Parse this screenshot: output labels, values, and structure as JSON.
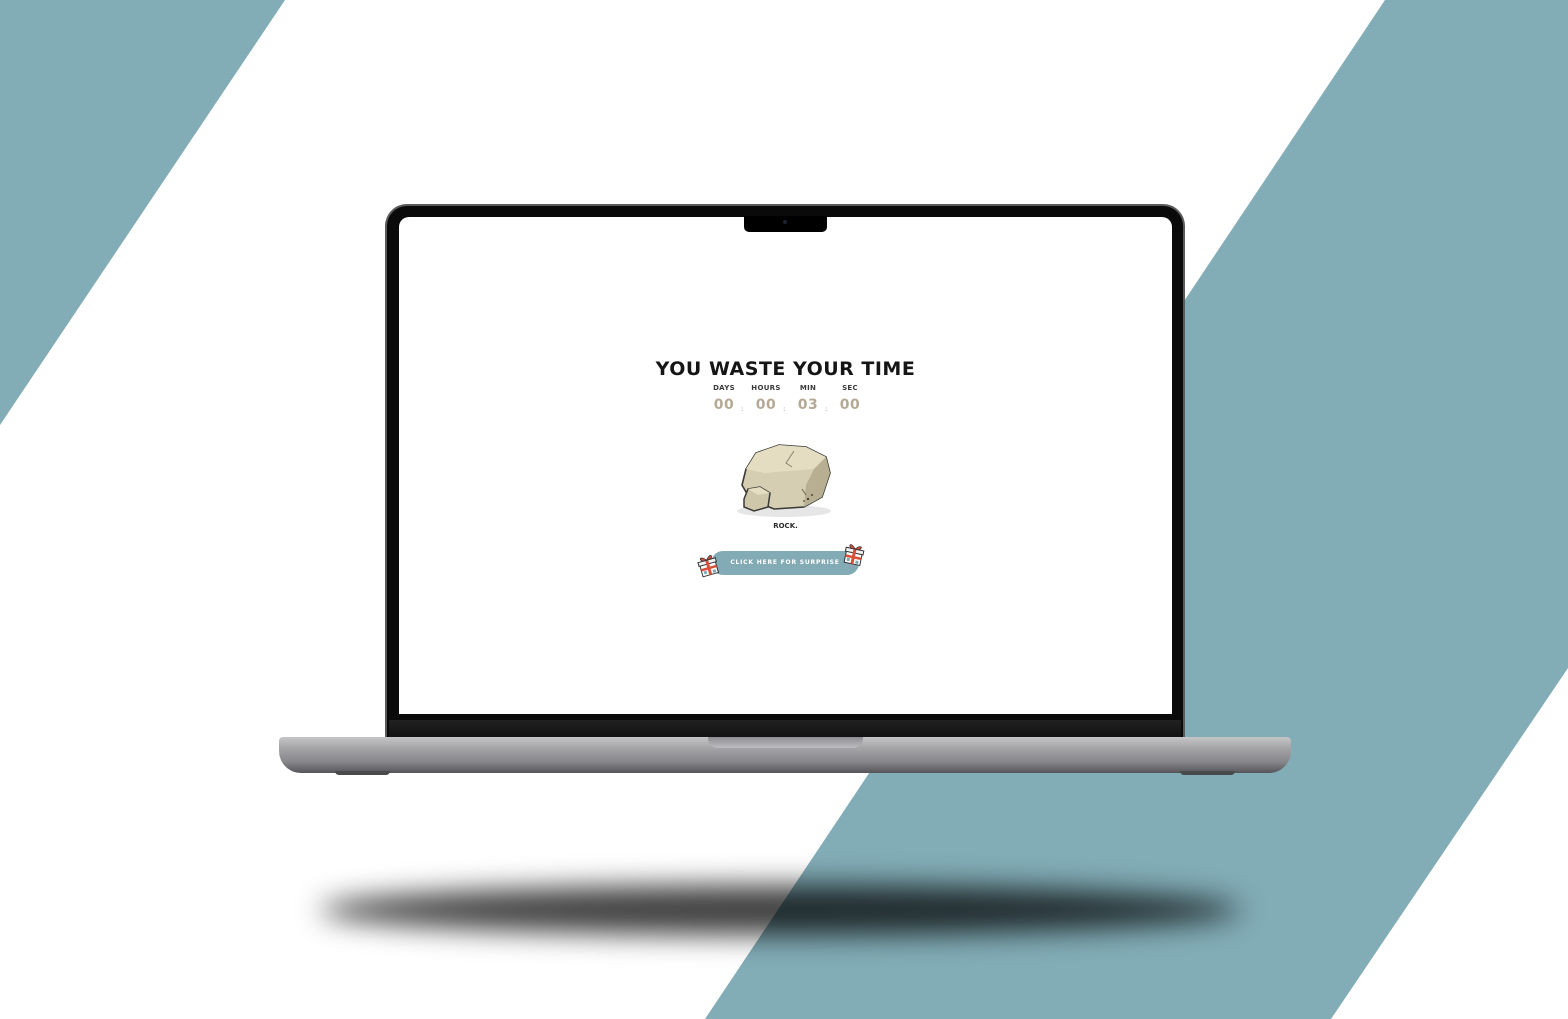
{
  "page": {
    "title": "YOU WASTE YOUR TIME",
    "accent_color": "#82abb5",
    "background_band_color": "#82acb6"
  },
  "countdown": {
    "units": [
      {
        "label": "DAYS",
        "value": "00"
      },
      {
        "label": "HOURS",
        "value": "00"
      },
      {
        "label": "MIN",
        "value": "03"
      },
      {
        "label": "SEC",
        "value": "00"
      }
    ],
    "separator": ":",
    "value_color": "#b5a996"
  },
  "rock": {
    "icon": "rock-icon",
    "caption": "ROCK."
  },
  "surprise": {
    "button_label": "CLICK HERE FOR SURPRISE",
    "icons": [
      "gift-icon",
      "gift-icon"
    ]
  }
}
